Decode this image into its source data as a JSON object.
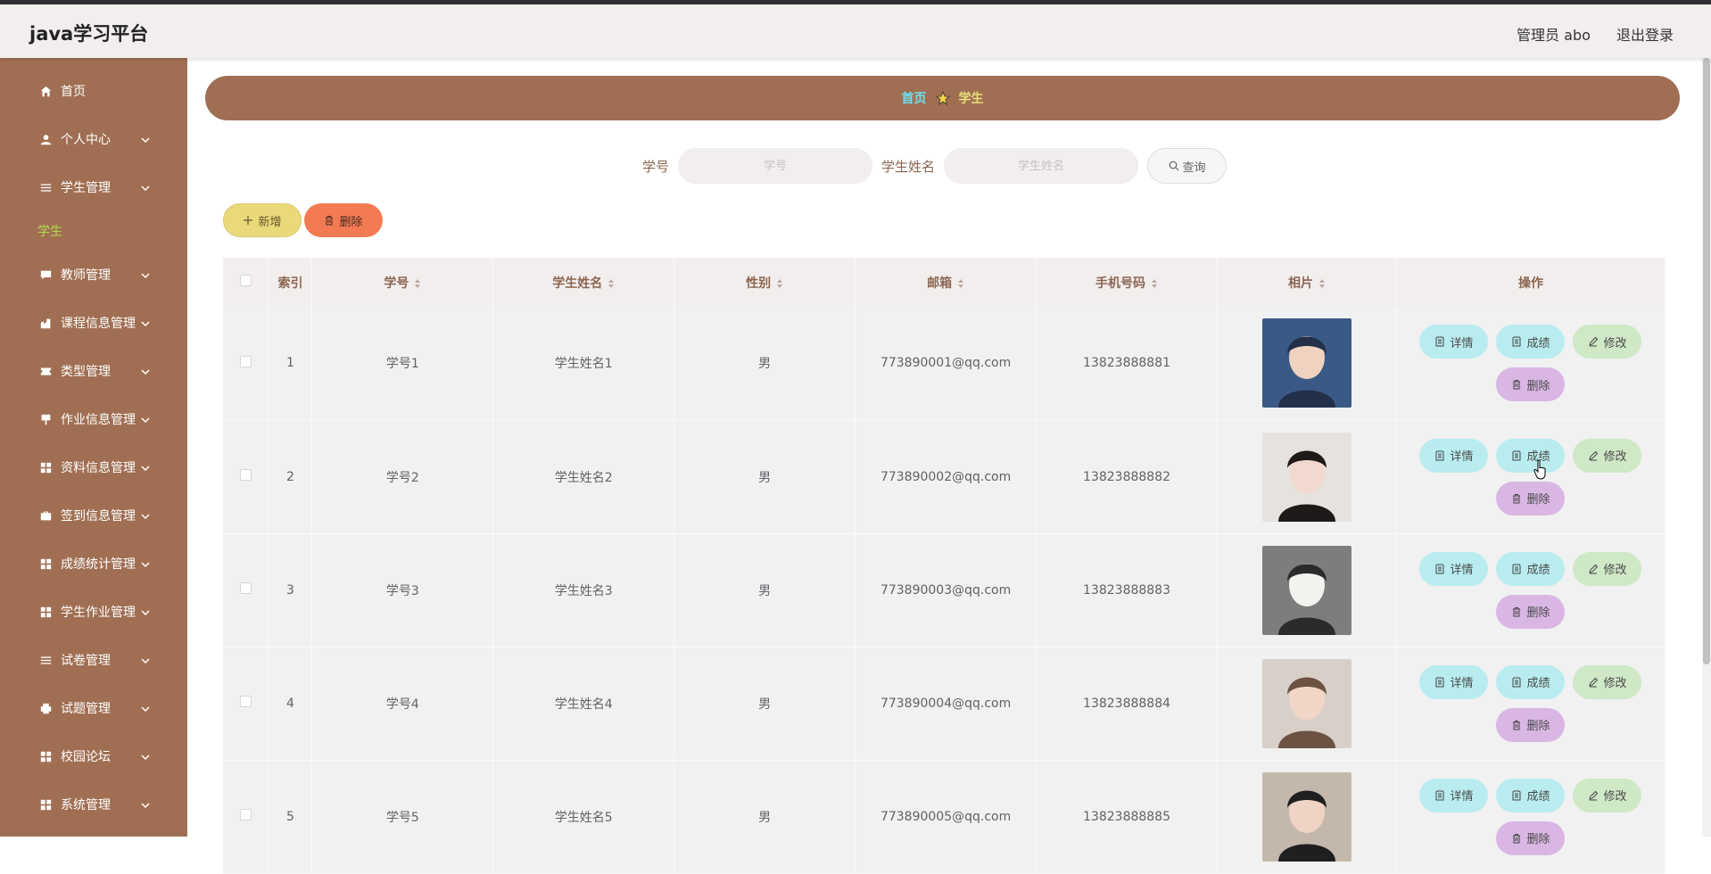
{
  "header": {
    "brand": "java学习平台",
    "admin_label": "管理员 abo",
    "logout_label": "退出登录"
  },
  "sidebar": {
    "items": [
      {
        "label": "首页",
        "icon": "home-icon",
        "expandable": false
      },
      {
        "label": "个人中心",
        "icon": "user-icon",
        "expandable": true
      },
      {
        "label": "学生管理",
        "icon": "list-icon",
        "expandable": true
      }
    ],
    "active_sub": "学生",
    "items2": [
      {
        "label": "教师管理",
        "icon": "chat-icon",
        "expandable": true
      },
      {
        "label": "课程信息管理",
        "icon": "building-icon",
        "expandable": true
      },
      {
        "label": "类型管理",
        "icon": "ticket-icon",
        "expandable": true
      },
      {
        "label": "作业信息管理",
        "icon": "flag-icon",
        "expandable": true
      },
      {
        "label": "资料信息管理",
        "icon": "grid-icon",
        "expandable": true
      },
      {
        "label": "签到信息管理",
        "icon": "briefcase-icon",
        "expandable": true
      },
      {
        "label": "成绩统计管理",
        "icon": "grid-icon",
        "expandable": true
      },
      {
        "label": "学生作业管理",
        "icon": "grid-icon",
        "expandable": true
      },
      {
        "label": "试卷管理",
        "icon": "list-icon",
        "expandable": true
      },
      {
        "label": "试题管理",
        "icon": "printer-icon",
        "expandable": true
      },
      {
        "label": "校园论坛",
        "icon": "grid-icon",
        "expandable": true
      },
      {
        "label": "系统管理",
        "icon": "grid-icon",
        "expandable": true
      }
    ]
  },
  "breadcrumb": {
    "home": "首页",
    "current": "学生"
  },
  "search": {
    "field1_label": "学号",
    "field1_placeholder": "学号",
    "field2_label": "学生姓名",
    "field2_placeholder": "学生姓名",
    "query_label": "查询"
  },
  "toolbar": {
    "add_label": "新增",
    "delete_label": "删除"
  },
  "table": {
    "headers": [
      "索引",
      "学号",
      "学生姓名",
      "性别",
      "邮箱",
      "手机号码",
      "相片",
      "操作"
    ],
    "op_labels": {
      "detail": "详情",
      "score": "成绩",
      "edit": "修改",
      "delete": "删除"
    },
    "rows": [
      {
        "index": "1",
        "student_no": "学号1",
        "name": "学生姓名1",
        "gender": "男",
        "email": "773890001@qq.com",
        "phone": "13823888881"
      },
      {
        "index": "2",
        "student_no": "学号2",
        "name": "学生姓名2",
        "gender": "男",
        "email": "773890002@qq.com",
        "phone": "13823888882"
      },
      {
        "index": "3",
        "student_no": "学号3",
        "name": "学生姓名3",
        "gender": "男",
        "email": "773890003@qq.com",
        "phone": "13823888883"
      },
      {
        "index": "4",
        "student_no": "学号4",
        "name": "学生姓名4",
        "gender": "男",
        "email": "773890004@qq.com",
        "phone": "13823888884"
      },
      {
        "index": "5",
        "student_no": "学号5",
        "name": "学生姓名5",
        "gender": "男",
        "email": "773890005@qq.com",
        "phone": "13823888885"
      }
    ]
  },
  "colors": {
    "sidebar_bg": "#a06f53",
    "active_sub": "#b3d94e",
    "breadcrumb_home": "#6ee0f0",
    "breadcrumb_current": "#e6e07a"
  }
}
